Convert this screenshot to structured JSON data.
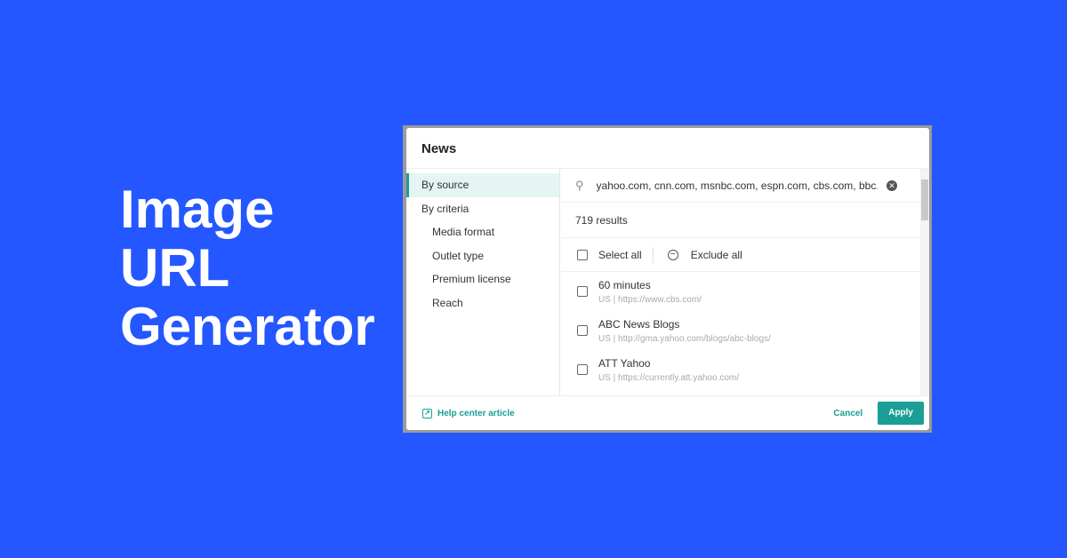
{
  "headline": [
    "Image",
    "URL",
    "Generator"
  ],
  "dialog": {
    "title": "News",
    "sidebar": [
      {
        "label": "By source",
        "active": true
      },
      {
        "label": "By criteria"
      },
      {
        "label": "Media format"
      },
      {
        "label": "Outlet type"
      },
      {
        "label": "Premium license"
      },
      {
        "label": "Reach"
      }
    ],
    "search": {
      "value": "yahoo.com, cnn.com, msnbc.com, espn.com, cbs.com, bbc.com"
    },
    "results": "719 results",
    "select_all": "Select all",
    "exclude_all": "Exclude all",
    "items": [
      {
        "name": "60 minutes",
        "url": "US | https://www.cbs.com/"
      },
      {
        "name": "ABC News Blogs",
        "url": "US | http://gma.yahoo.com/blogs/abc-blogs/"
      },
      {
        "name": "ATT Yahoo",
        "url": "US | https://currently.att.yahoo.com/"
      }
    ],
    "help": "Help center article",
    "cancel": "Cancel",
    "apply": "Apply",
    "accent": "#1a9e96"
  }
}
